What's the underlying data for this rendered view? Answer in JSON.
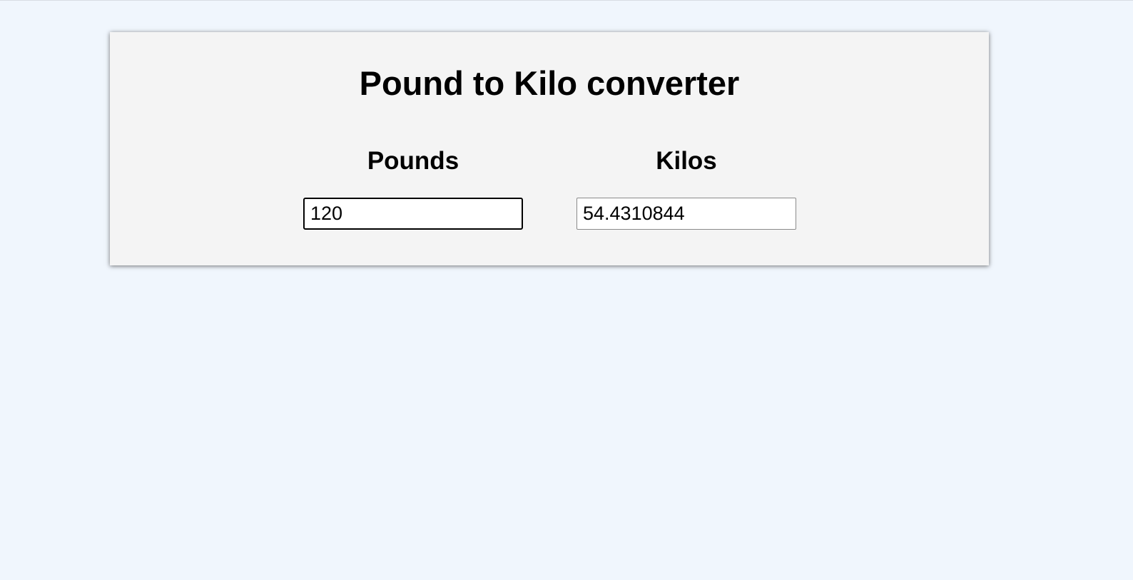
{
  "converter": {
    "title": "Pound to Kilo converter",
    "pounds": {
      "label": "Pounds",
      "value": "120"
    },
    "kilos": {
      "label": "Kilos",
      "value": "54.4310844"
    }
  }
}
